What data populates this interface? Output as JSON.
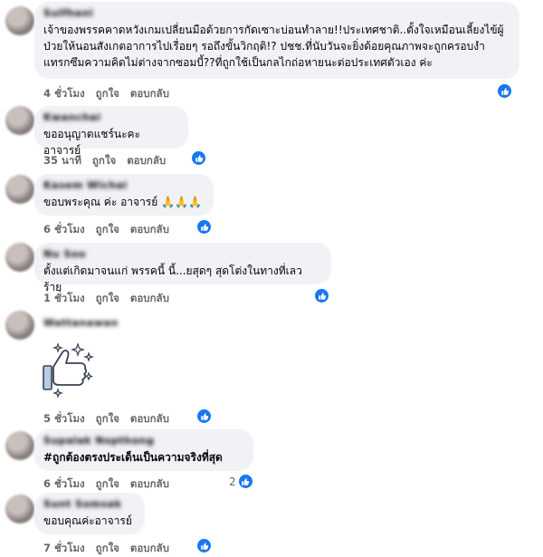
{
  "actions": {
    "like_label": "ถูกใจ",
    "reply_label": "ตอบกลับ"
  },
  "comments": [
    {
      "author": "Sulfhani",
      "text": "เจ้าของพรรคคาดหวังเกมเปลี่ยนมือด้วยการกัดเซาะบ่อนทำลาย!!ประเทศชาติ..ตั้งใจเหมือนเลี้ยงไข้ผู้ป่วยให้นอนสังเกตอาการไปเรื่อยๆ รอถึงขั้นวิกฤติ!? ปชช.ที่นับวันจะยิ่งด้อยคุณภาพจะถูกครอบงำแทรกซึมความคิดไม่ต่างจากซอมบี้??ที่ถูกใช้เป็นกลไกถ่อหายนะต่อประเทศตัวเอง ค่ะ",
      "time": "4 ชั่วโมง",
      "reaction_count": ""
    },
    {
      "author": "Kwanchai",
      "text": "ขออนุญาตแชร์นะคะอาจารย์",
      "time": "35 นาที",
      "reaction_count": ""
    },
    {
      "author": "Kasem Wichai",
      "text": "ขอบพระคุณ ค่ะ อาจารย์ 🙏🙏🙏",
      "time": "6 ชั่วโมง",
      "reaction_count": ""
    },
    {
      "author": "Nu Soo",
      "text": "ตั้งแต่เกิดมาจนแก่ พรรคนี้ นี้...ยสุดๆ สุดโต่งในทางที่เลวร้าย",
      "time": "1 ชั่วโมง",
      "reaction_count": ""
    },
    {
      "author": "Wattanawan",
      "text": "",
      "time": "5 ชั่วโมง",
      "reaction_count": ""
    },
    {
      "author": "Supalak Nopthong",
      "text": "#ถูกต้องตรงประเด็นเป็นความจริงที่สุด",
      "time": "6 ชั่วโมง",
      "reaction_count": "2"
    },
    {
      "author": "Sunt Somsak",
      "text": "ขอบคุณค่ะอาจารย์",
      "time": "7 ชั่วโมง",
      "reaction_count": ""
    }
  ],
  "colors": {
    "bubble": "#f0f2f5",
    "action_text": "#65676b",
    "like_blue": "#1877f2"
  },
  "icons": {
    "reaction": "like-icon",
    "sticker": "thumbs-up-sparkle-sticker"
  }
}
